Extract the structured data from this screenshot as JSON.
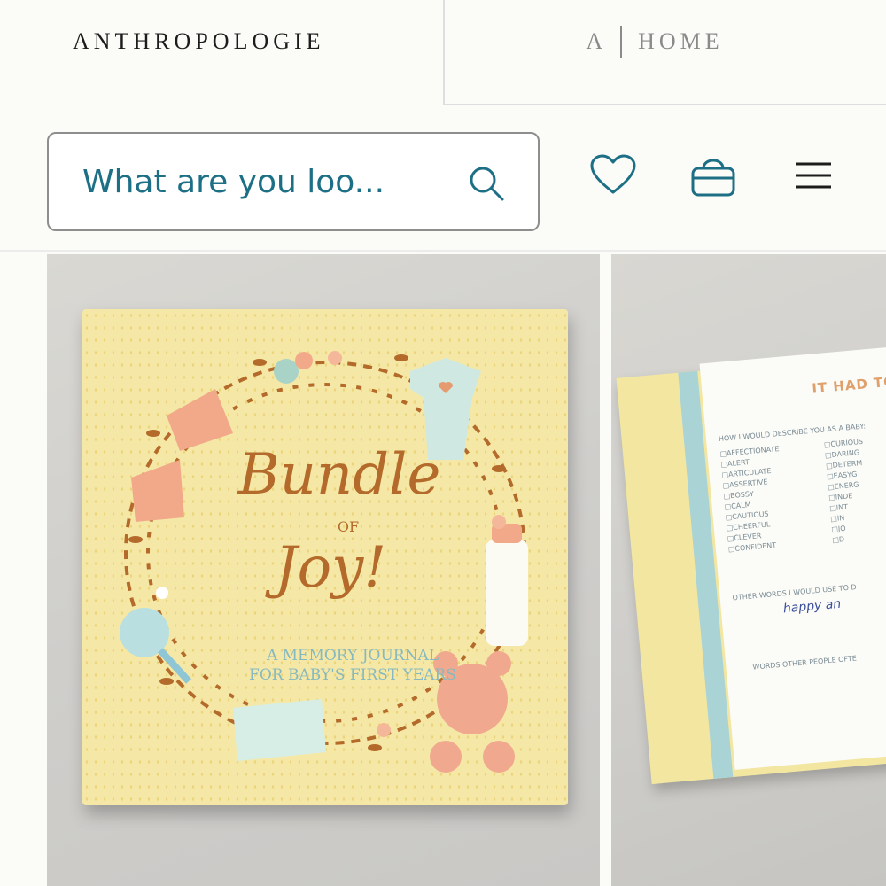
{
  "header": {
    "brand_name": "ANTHROPOLOGIE",
    "home_logo_letter": "A",
    "home_label": "HOME"
  },
  "search": {
    "placeholder": "What are you loo..."
  },
  "icons": {
    "search": "search-icon",
    "wishlist": "heart-icon",
    "bag": "shopping-bag-icon",
    "menu": "hamburger-menu-icon"
  },
  "colors": {
    "accent": "#1d6f86",
    "book_cover": "#f5e8a6",
    "book_text": "#b46a2a"
  },
  "product": {
    "book_title_line1": "Bundle",
    "book_title_of": "OF",
    "book_title_line2": "Joy!",
    "book_subtitle_line1": "A Memory Journal",
    "book_subtitle_line2": "for Baby's First Years"
  },
  "journal": {
    "heading": "IT HAD TO",
    "question": "HOW I WOULD DESCRIBE YOU AS A BABY:",
    "col1": [
      "AFFECTIONATE",
      "ALERT",
      "ARTICULATE",
      "ASSERTIVE",
      "BOSSY",
      "CALM",
      "CAUTIOUS",
      "CHEERFUL",
      "CLEVER",
      "CONFIDENT"
    ],
    "col2": [
      "CURIOUS",
      "DARING",
      "DETERM",
      "EASYG",
      "ENERG",
      "INDE",
      "INT",
      "IN",
      "JO",
      "D"
    ],
    "other_words": "OTHER WORDS I WOULD USE TO D",
    "handwriting": "happy an",
    "other_people": "WORDS OTHER PEOPLE OFTE"
  }
}
